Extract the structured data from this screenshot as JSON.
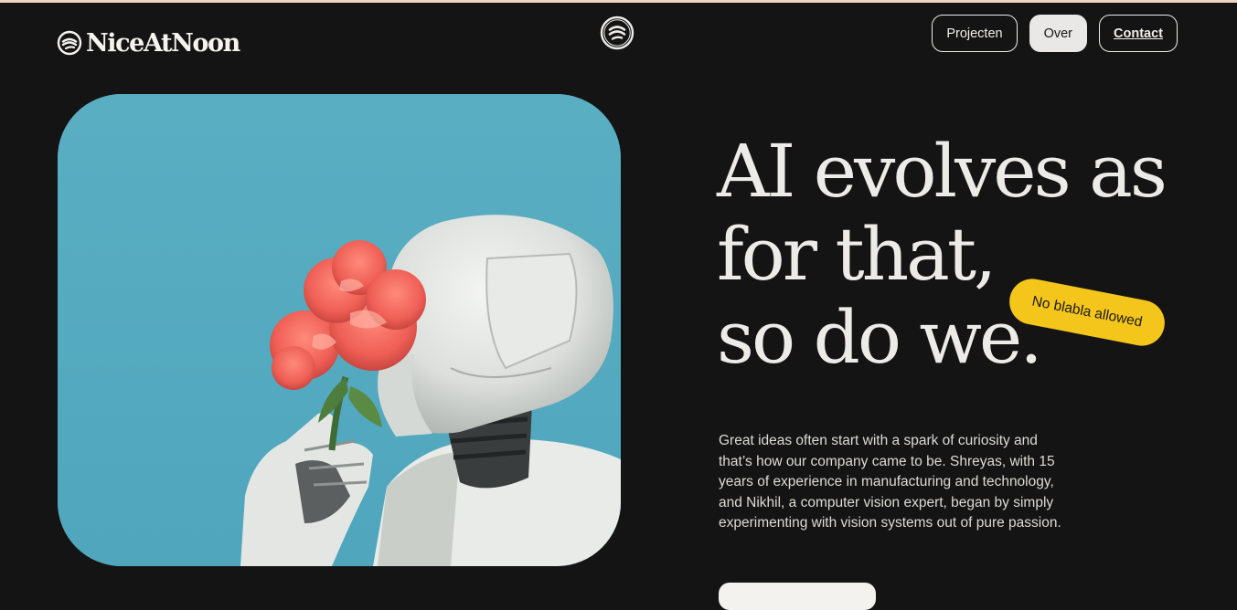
{
  "brand": {
    "name": "NiceAtNoon",
    "logo_icon": "nice-at-noon-mark"
  },
  "nav": {
    "items": [
      {
        "label": "Projecten",
        "state": "default"
      },
      {
        "label": "Over",
        "state": "active"
      },
      {
        "label": "Contact",
        "state": "emphasized"
      }
    ]
  },
  "hero": {
    "headline_lines": [
      "AI evolves as",
      "for that,",
      "so do we."
    ],
    "sticker": "No blabla allowed",
    "body": "Great ideas often start with a spark of curiosity and that’s how our company came to be. Shreyas, with 15 years of experience in manufacturing and technology, and Nikhil, a computer vision expert, began by simply experimenting with vision systems out of pure passion.",
    "image_subject": "white robot holding pink peonies against a blue sky"
  },
  "colors": {
    "background": "#141414",
    "sticker": "#f4c51b",
    "sky": "#55abc0",
    "text": "#ecebe7"
  }
}
